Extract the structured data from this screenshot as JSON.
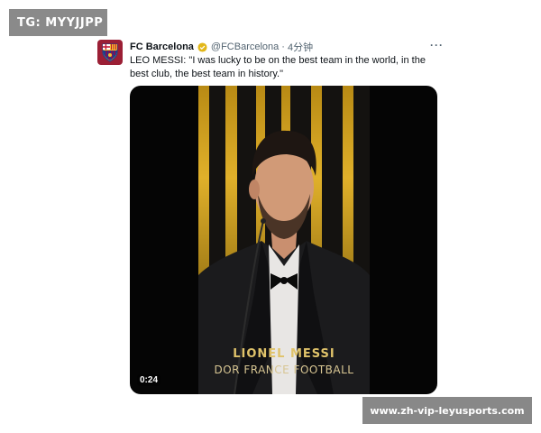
{
  "watermark_top": "TG: MYYJJPP",
  "watermark_bottom": "www.zh-vip-leyusports.com",
  "tweet": {
    "author_name": "FC Barcelona",
    "handle": "@FCBarcelona",
    "separator": "·",
    "time": "4分钟",
    "text": "LEO MESSI: \"I was lucky to be on the best team in the world, in the best club, the best team in history.\"",
    "more_label": "···",
    "avatar_icon": "fc-barcelona-crest-icon",
    "verified_icon": "gold-verified-badge-icon",
    "verified_color": "#e2b719",
    "video": {
      "caption_line1": "LIONEL MESSI",
      "caption_line2": "DOR FRANCE FOOTBALL",
      "duration": "0:24"
    }
  },
  "colors": {
    "text": "#0f1419",
    "muted": "#536471",
    "crest": "#9b1f35",
    "gold": "#e0b02a"
  }
}
